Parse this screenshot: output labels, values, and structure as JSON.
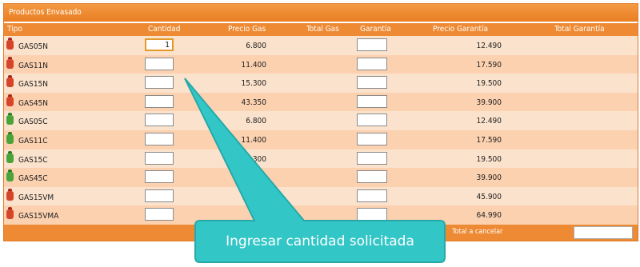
{
  "panel": {
    "title": "Productos Envasado"
  },
  "columns": [
    "Tipo",
    "Cantidad",
    "Precio Gas",
    "Total Gas",
    "Garantía",
    "Precio Garantía",
    "Total Garantía"
  ],
  "rows": [
    {
      "tipo": "GAS05N",
      "color": "red",
      "cantidad": "1",
      "precio_gas": "6.800",
      "garantia": "",
      "precio_garantia": "12.490"
    },
    {
      "tipo": "GAS11N",
      "color": "red",
      "cantidad": "",
      "precio_gas": "11.400",
      "garantia": "",
      "precio_garantia": "17.590"
    },
    {
      "tipo": "GAS15N",
      "color": "red",
      "cantidad": "",
      "precio_gas": "15.300",
      "garantia": "",
      "precio_garantia": "19.500"
    },
    {
      "tipo": "GAS45N",
      "color": "red",
      "cantidad": "",
      "precio_gas": "43.350",
      "garantia": "",
      "precio_garantia": "39.900"
    },
    {
      "tipo": "GAS05C",
      "color": "green",
      "cantidad": "",
      "precio_gas": "6.800",
      "garantia": "",
      "precio_garantia": "12.490"
    },
    {
      "tipo": "GAS11C",
      "color": "green",
      "cantidad": "",
      "precio_gas": "11.400",
      "garantia": "",
      "precio_garantia": "17.590"
    },
    {
      "tipo": "GAS15C",
      "color": "green",
      "cantidad": "",
      "precio_gas": "300",
      "garantia": "",
      "precio_garantia": "19.500"
    },
    {
      "tipo": "GAS45C",
      "color": "green",
      "cantidad": "",
      "precio_gas": "",
      "garantia": "",
      "precio_garantia": "39.900"
    },
    {
      "tipo": "GAS15VM",
      "color": "red",
      "cantidad": "",
      "precio_gas": "",
      "garantia": "",
      "precio_garantia": "45.900"
    },
    {
      "tipo": "GAS15VMA",
      "color": "red",
      "cantidad": "",
      "precio_gas": "",
      "garantia": "",
      "precio_garantia": "64.990"
    }
  ],
  "footer": {
    "total_label": "Total a cancelar",
    "total_value": ""
  },
  "callout": {
    "text": "Ingresar cantidad solicitada"
  },
  "colors": {
    "header": "#ee8a33",
    "row_light": "#fbe2cc",
    "row_dark": "#fcd1b0",
    "callout": "#33c6c6"
  }
}
